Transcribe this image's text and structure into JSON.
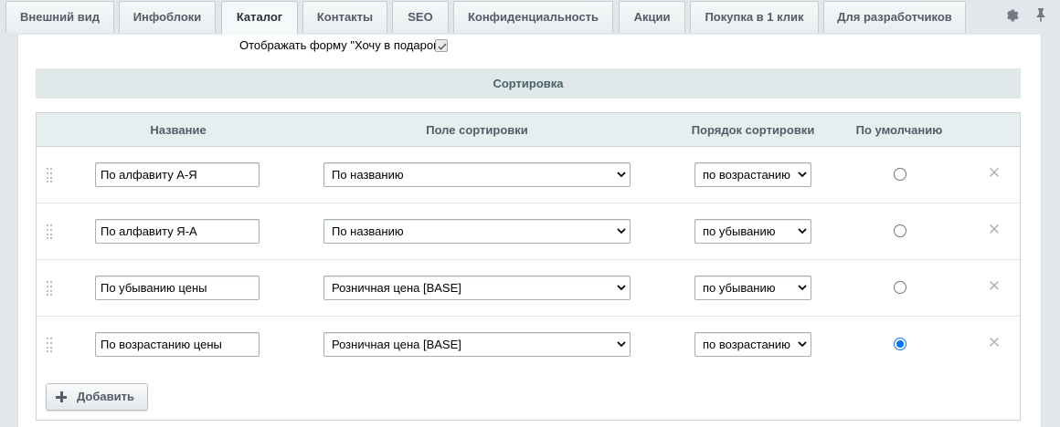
{
  "tabs": [
    {
      "label": "Внешний вид"
    },
    {
      "label": "Инфоблоки"
    },
    {
      "label": "Каталог"
    },
    {
      "label": "Контакты"
    },
    {
      "label": "SEO"
    },
    {
      "label": "Конфиденциальность"
    },
    {
      "label": "Акции"
    },
    {
      "label": "Покупка в 1 клик"
    },
    {
      "label": "Для разработчиков"
    }
  ],
  "active_tab": "Каталог",
  "tools": {
    "settings_icon": "gear-icon",
    "pin_icon": "pin-icon"
  },
  "gift_form": {
    "label": "Отображать форму \"Хочу в подарок\":",
    "checked": true
  },
  "sorting": {
    "title": "Сортировка",
    "headers": {
      "name": "Название",
      "field": "Поле сортировки",
      "order": "Порядок сортировки",
      "default": "По умолчанию"
    },
    "rows": [
      {
        "name": "По алфавиту А-Я",
        "field": "По названию",
        "order": "по возрастанию",
        "is_default": false
      },
      {
        "name": "По алфавиту Я-А",
        "field": "По названию",
        "order": "по убыванию",
        "is_default": false
      },
      {
        "name": "По убыванию цены",
        "field": "Розничная цена [BASE]",
        "order": "по убыванию",
        "is_default": false
      },
      {
        "name": "По возрастанию цены",
        "field": "Розничная цена [BASE]",
        "order": "по возрастанию",
        "is_default": true
      }
    ],
    "add_label": "Добавить"
  },
  "colors": {
    "accent": "#0075ff",
    "header_bg": "#e0e8ea",
    "page_bg": "#e1e7eb"
  }
}
